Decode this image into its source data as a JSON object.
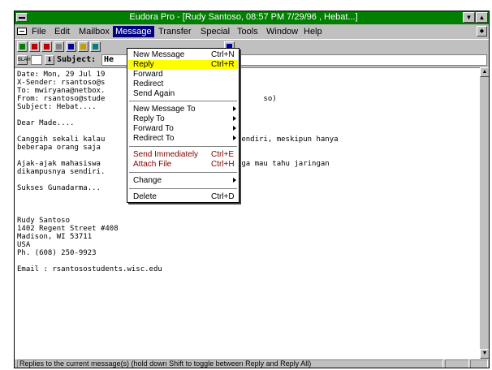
{
  "window": {
    "title": "Eudora Pro - [Rudy Santoso, 08:57 PM 7/29/96 , Hebat...]"
  },
  "menubar": {
    "items": [
      "File",
      "Edit",
      "Mailbox",
      "Message",
      "Transfer",
      "Special",
      "Tools",
      "Window",
      "Help"
    ],
    "active": "Message"
  },
  "subject": {
    "label": "Subject:",
    "value": "He"
  },
  "message_menu": {
    "items": [
      {
        "label": "New Message",
        "accel": "Ctrl+N"
      },
      {
        "label": "Reply",
        "accel": "Ctrl+R"
      },
      {
        "label": "Forward",
        "accel": ""
      },
      {
        "label": "Redirect",
        "accel": ""
      },
      {
        "label": "Send Again",
        "accel": ""
      },
      {
        "label": "New Message To",
        "accel": ""
      },
      {
        "label": "Reply To",
        "accel": ""
      },
      {
        "label": "Forward To",
        "accel": ""
      },
      {
        "label": "Redirect To",
        "accel": ""
      },
      {
        "label": "Send Immediately",
        "accel": "Ctrl+E"
      },
      {
        "label": "Attach File",
        "accel": "Ctrl+H"
      },
      {
        "label": "Change",
        "accel": ""
      },
      {
        "label": "Delete",
        "accel": "Ctrl+D"
      }
    ]
  },
  "body_lines": [
    "Date: Mon, 29 Jul 19",
    "X-Sender: rsantoso@s",
    "To: mwiryana@netbox.",
    "From: rsantoso@stude                                    so)",
    "Subject: Hebat....",
    "",
    "Dear Made....",
    "",
    "Canggih sekali kalau                      aringan sendiri, meskipun hanya",
    "beberapa orang saja                       ni.",
    "",
    "Ajak-ajak mahasiswa                       mereka juga mau tahu jaringan",
    "dikampusnya sendiri.",
    "",
    "Sukses Gunadarma...",
    "",
    "",
    "",
    "Rudy Santoso",
    "1402 Regent Street #408",
    "Madison, WI 53711",
    "USA",
    "Ph. (608) 250-9923",
    "",
    "Email : rsantosostudents.wisc.edu"
  ],
  "status": {
    "text": "Replies to the current message(s) (hold down Shift to toggle between Reply and Reply All)"
  },
  "colors": {
    "title_bar": "#008000",
    "menu_highlight": "#000080",
    "selected_item": "#ffff00",
    "dimmed_item": "#800000"
  }
}
